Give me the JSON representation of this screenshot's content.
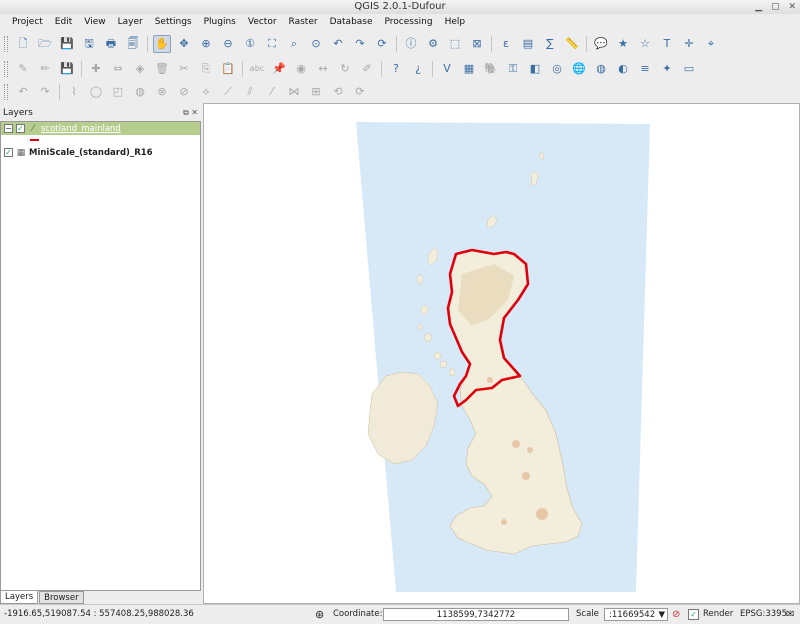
{
  "window": {
    "title": "QGIS 2.0.1-Dufour"
  },
  "menu": [
    "Project",
    "Edit",
    "View",
    "Layer",
    "Settings",
    "Plugins",
    "Vector",
    "Raster",
    "Database",
    "Processing",
    "Help"
  ],
  "icons": {
    "toolbar1": [
      "new-project-icon",
      "open-project-icon",
      "save-project-icon",
      "save-as-icon",
      "new-print-composer-icon",
      "composer-manager-icon",
      "pan-icon",
      "pan-to-selection-icon",
      "zoom-in-icon",
      "zoom-out-icon",
      "zoom-actual-size-icon",
      "zoom-full-icon",
      "zoom-to-selection-icon",
      "zoom-to-layer-icon",
      "zoom-last-icon",
      "zoom-next-icon",
      "refresh-icon",
      "identify-icon",
      "run-feature-action-icon",
      "select-features-icon",
      "deselect-icon",
      "field-calculator-icon",
      "open-attribute-table-icon",
      "statistical-summary-icon",
      "measure-line-icon",
      "map-tips-icon",
      "new-bookmark-icon",
      "show-bookmarks-icon",
      "text-annotation-icon",
      "coordinate-capture-icon",
      "georeferencer-icon"
    ],
    "toolbar2": [
      "current-edits-icon",
      "toggle-editing-icon",
      "save-layer-edits-icon",
      "add-feature-icon",
      "move-feature-icon",
      "node-tool-icon",
      "delete-selected-icon",
      "cut-features-icon",
      "copy-features-icon",
      "paste-features-icon",
      "label-tool-icon",
      "pin-labels-icon",
      "show-labels-icon",
      "move-label-icon",
      "rotate-label-icon",
      "change-label-icon",
      "help-contents-icon",
      "whats-this-icon",
      "add-vector-layer-icon",
      "add-raster-layer-icon",
      "add-postgis-layer-icon",
      "add-spatialite-layer-icon",
      "add-mssql-layer-icon",
      "add-oracle-layer-icon",
      "add-wms-layer-icon",
      "add-wcs-layer-icon",
      "add-wfs-layer-icon",
      "add-delimited-text-icon",
      "new-shapefile-layer-icon",
      "remove-layer-icon"
    ],
    "toolbar3": [
      "undo-icon",
      "redo-icon",
      "simplify-feature-icon",
      "add-ring-icon",
      "add-part-icon",
      "fill-ring-icon",
      "delete-ring-icon",
      "delete-part-icon",
      "reshape-features-icon",
      "offset-curve-icon",
      "split-features-icon",
      "split-parts-icon",
      "merge-features-icon",
      "merge-attributes-icon",
      "rotate-point-symbols-icon",
      "rotate-feature-icon"
    ]
  },
  "layers_panel": {
    "title": "Layers",
    "layers": [
      {
        "name": "scotland_mainland",
        "type": "vector-line",
        "checked": true,
        "selected": true,
        "color": "#e0000c"
      },
      {
        "name": "MiniScale_(standard)_R16",
        "type": "raster",
        "checked": true,
        "selected": false
      }
    ],
    "tabs": [
      {
        "label": "Layers",
        "active": true
      },
      {
        "label": "Browser",
        "active": false
      }
    ]
  },
  "map": {
    "sea_color": "#d7e9f7",
    "land_color": "#f3eddc",
    "outline_color": "#e0000c"
  },
  "statusbar": {
    "extents": "-1916.65,519087.54 : 557408.25,988028.36",
    "coordinate_label": "Coordinate:",
    "coordinate_value": "1138599,7342772",
    "scale_label": "Scale",
    "scale_value": ":11669542",
    "render_label": "Render",
    "crs": "EPSG:3395"
  }
}
